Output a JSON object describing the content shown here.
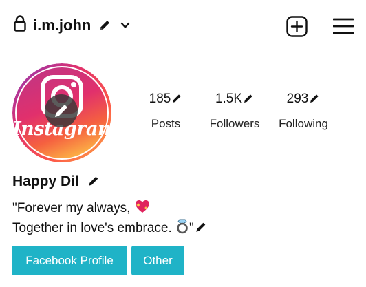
{
  "header": {
    "username": "i.m.john",
    "lock_icon": "lock-icon",
    "edit_icon": "pencil-icon",
    "dropdown_icon": "chevron-down-icon",
    "create_icon": "plus-square-icon",
    "menu_icon": "hamburger-menu-icon"
  },
  "avatar": {
    "label": "Instagram",
    "edit_icon": "pencil-icon"
  },
  "stats": [
    {
      "value": "185",
      "label": "Posts"
    },
    {
      "value": "1.5K",
      "label": "Followers"
    },
    {
      "value": "293",
      "label": "Following"
    }
  ],
  "profile": {
    "display_name": "Happy Dil",
    "bio_line1": "\"Forever my always,",
    "bio_line2_text": "Together in love's embrace.",
    "bio_line2_quote": "\"",
    "emoji1": "sparkling-heart-icon",
    "emoji2": "ring-icon"
  },
  "buttons": {
    "facebook_label": "Facebook Profile",
    "other_label": "Other"
  },
  "colors": {
    "button_bg": "#1fb3c7",
    "text": "#111111"
  }
}
